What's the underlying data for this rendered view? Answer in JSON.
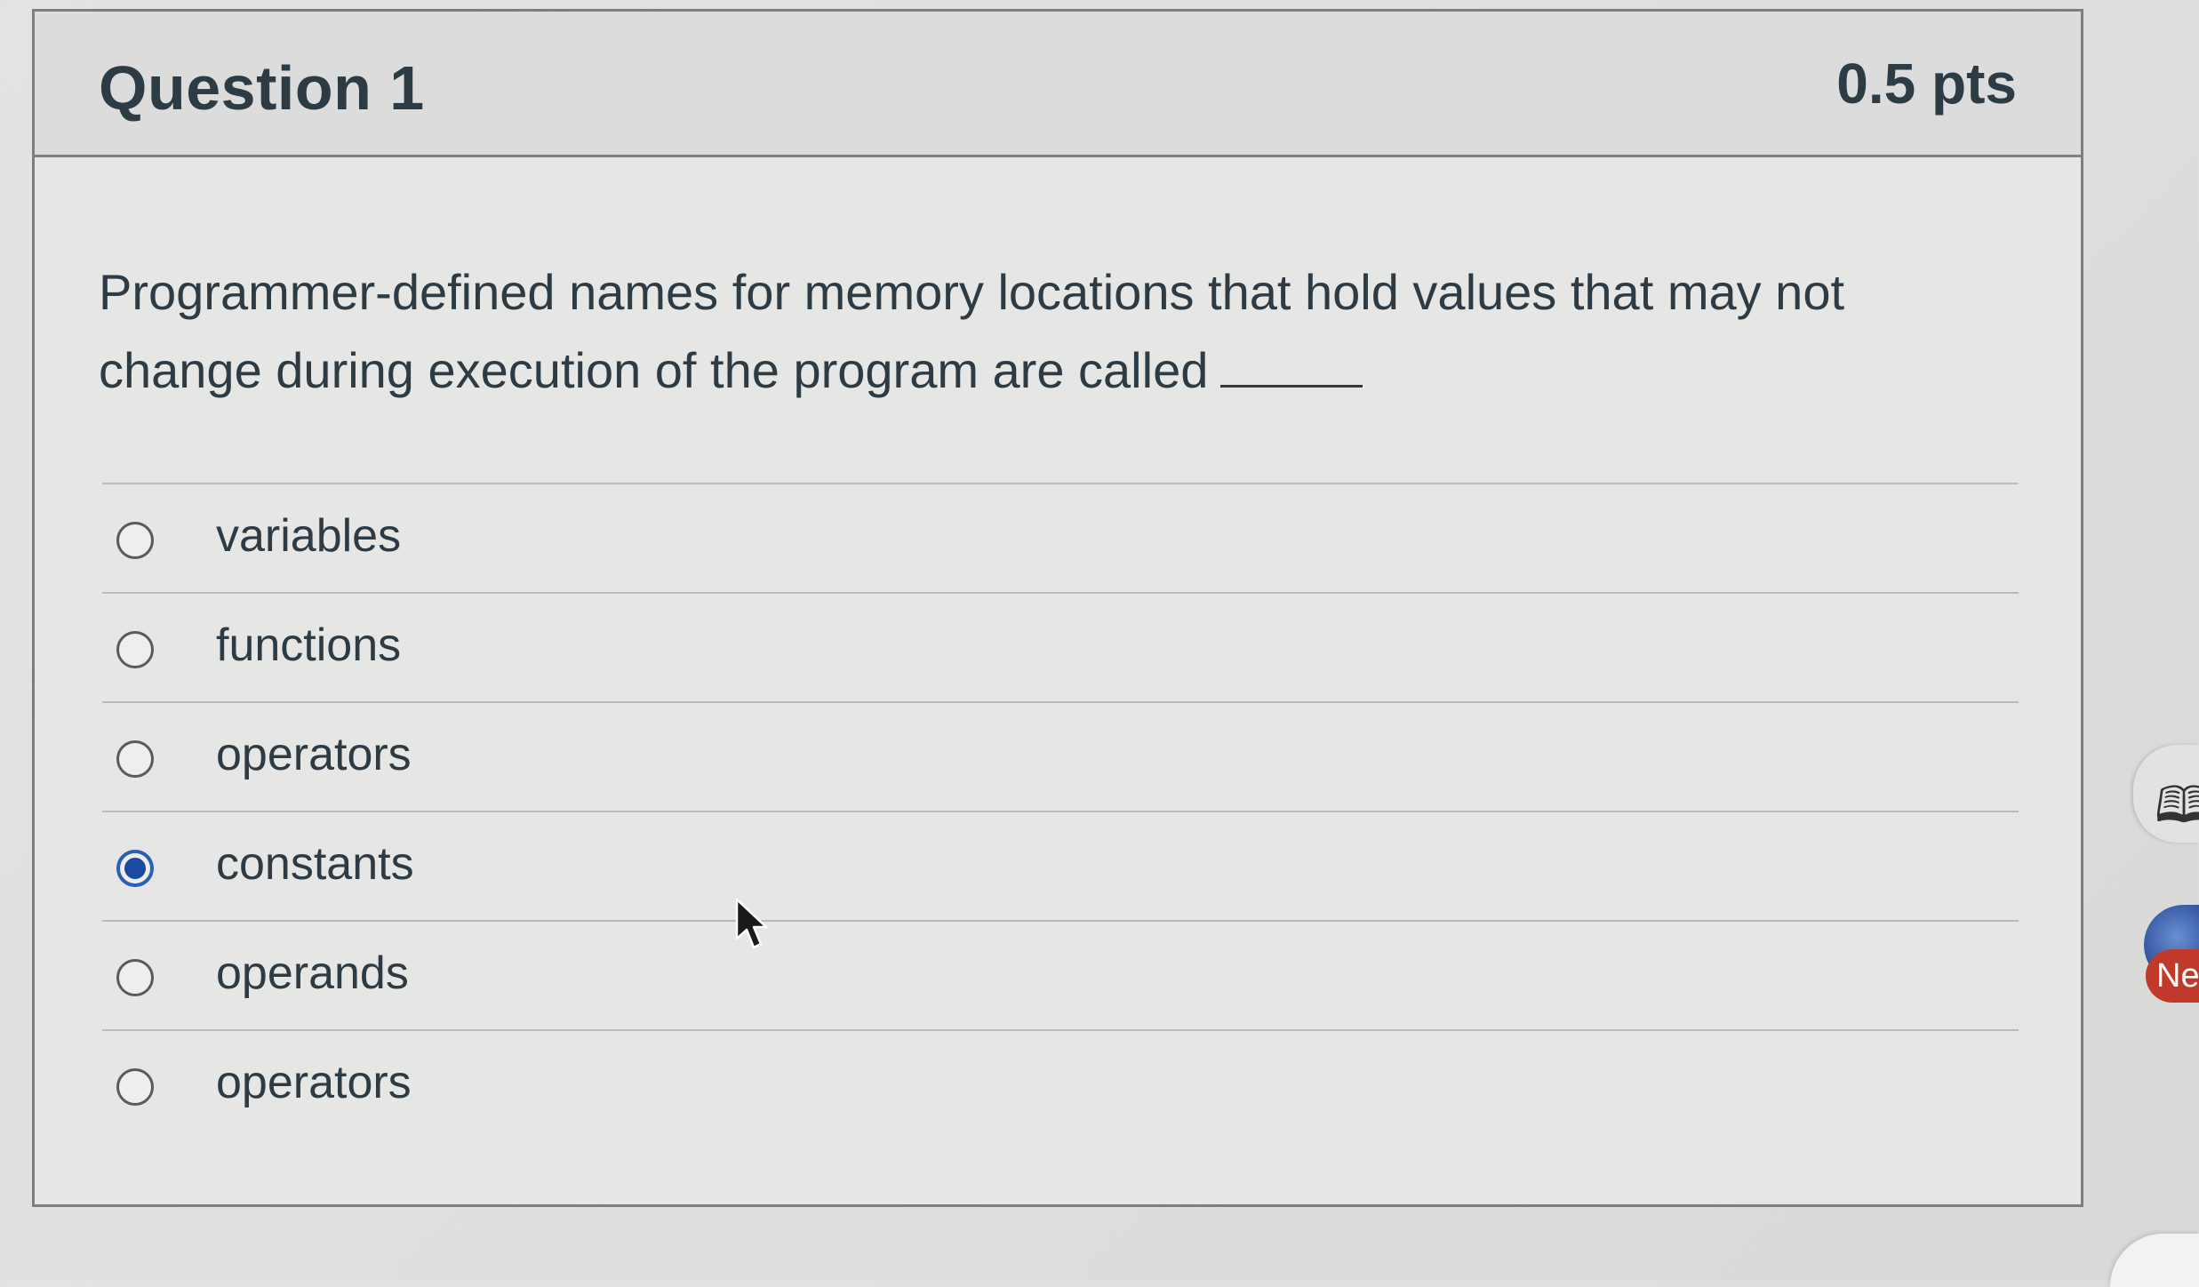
{
  "question": {
    "title": "Question 1",
    "points": "0.5 pts",
    "text": "Programmer-defined names for memory locations that hold values that may not change during execution of the program are called"
  },
  "answers": [
    {
      "label": "variables",
      "checked": false
    },
    {
      "label": "functions",
      "checked": false
    },
    {
      "label": "operators",
      "checked": false
    },
    {
      "label": "constants",
      "checked": true
    },
    {
      "label": "operands",
      "checked": false
    },
    {
      "label": "operators",
      "checked": false
    }
  ],
  "side_panel": {
    "badge_text": "Ne",
    "tab_icon": "book-icon",
    "avatar_icon": "globe-avatar-icon"
  },
  "colors": {
    "selected_radio": "#1b4aa0",
    "text": "#2d3b45",
    "badge": "#c0392b"
  }
}
